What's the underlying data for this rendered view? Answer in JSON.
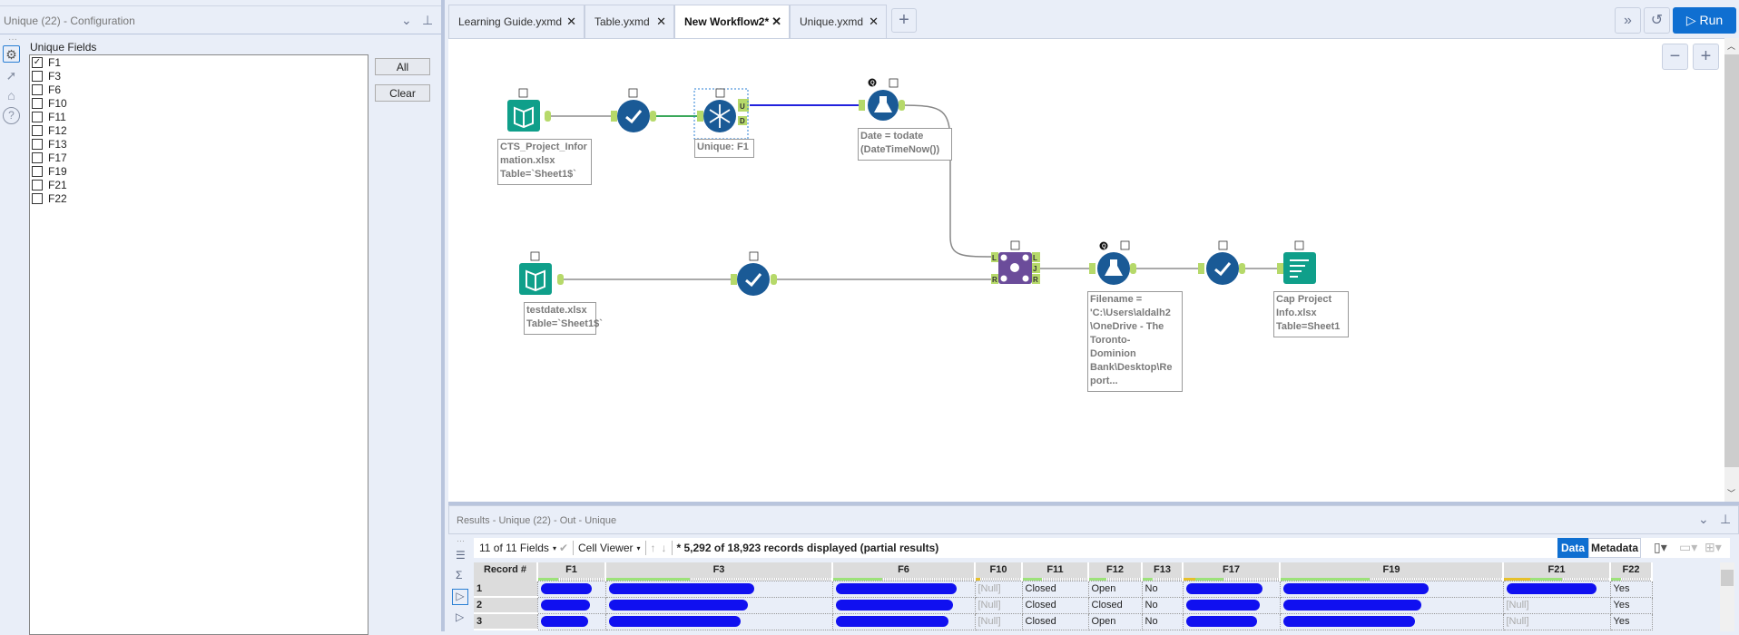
{
  "config_panel": {
    "title": "Unique (22) - Configuration",
    "section_label": "Unique Fields",
    "fields": [
      {
        "name": "F1",
        "checked": true
      },
      {
        "name": "F3",
        "checked": false
      },
      {
        "name": "F6",
        "checked": false
      },
      {
        "name": "F10",
        "checked": false
      },
      {
        "name": "F11",
        "checked": false
      },
      {
        "name": "F12",
        "checked": false
      },
      {
        "name": "F13",
        "checked": false
      },
      {
        "name": "F17",
        "checked": false
      },
      {
        "name": "F19",
        "checked": false
      },
      {
        "name": "F21",
        "checked": false
      },
      {
        "name": "F22",
        "checked": false
      }
    ],
    "all_label": "All",
    "clear_label": "Clear",
    "side_icons": [
      "gear-icon",
      "connection-icon",
      "tag-icon",
      "help-icon"
    ]
  },
  "tabs": [
    {
      "label": "Learning Guide.yxmd",
      "active": false
    },
    {
      "label": "Table.yxmd",
      "active": false
    },
    {
      "label": "New Workflow2*",
      "active": true
    },
    {
      "label": "Unique.yxmd",
      "active": false
    }
  ],
  "toolbar": {
    "run_label": "Run",
    "accent": "#0f6fd1"
  },
  "workflow": {
    "input1_label": "CTS_Project_Infor\nmation.xlsx\nTable=`Sheet1$`",
    "unique_label": "Unique: F1",
    "formula1_label": "Date = todate\n(DateTimeNow())",
    "input2_label": "testdate.xlsx\nTable=`Sheet1$`",
    "formula2_label": "Filename =\n'C:\\Users\\aldalh2\n\\OneDrive - The\nToronto-\nDominion\nBank\\Desktop\\Re\nport...",
    "output_label": "Cap Project\nInfo.xlsx\nTable=Sheet1",
    "anchors": {
      "unique_out": "U",
      "unique_dup": "D",
      "join_left": "L",
      "join_right": "R",
      "join_out_left": "L",
      "join_out_join": "J",
      "join_out_right": "R"
    },
    "badge_cache": "Q"
  },
  "results": {
    "title": "Results - Unique (22) - Out - Unique",
    "fields_selector": "11 of 11 Fields",
    "cell_viewer": "Cell Viewer",
    "status": "* 5,292 of 18,923 records displayed (partial results)",
    "data_tab": "Data",
    "metadata_tab": "Metadata",
    "columns": [
      "Record #",
      "F1",
      "F3",
      "F6",
      "F10",
      "F11",
      "F12",
      "F13",
      "F17",
      "F19",
      "F21",
      "F22"
    ],
    "rows": [
      [
        "1",
        "",
        "",
        "",
        "[Null]",
        "Closed",
        "Open",
        "No",
        "",
        "",
        "",
        "Yes"
      ],
      [
        "2",
        "",
        "",
        "",
        "[Null]",
        "Closed",
        "Closed",
        "No",
        "",
        "",
        "[Null]",
        "Yes"
      ],
      [
        "3",
        "",
        "",
        "",
        "[Null]",
        "Closed",
        "Open",
        "No",
        "",
        "",
        "[Null]",
        "Yes"
      ]
    ]
  }
}
